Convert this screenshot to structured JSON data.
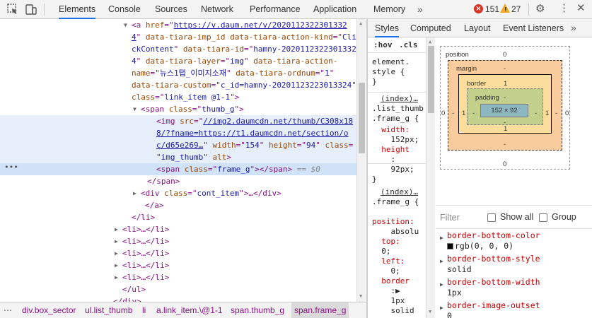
{
  "toolbar": {
    "tabs": [
      "Elements",
      "Console",
      "Sources",
      "Network",
      "Performance",
      "Application",
      "Memory"
    ],
    "more": "»",
    "errors": "151",
    "warnings": "27",
    "error_icon": "×",
    "warn_icon": "!"
  },
  "dom": {
    "rows": [
      [
        {
          "c": "tri",
          "t": "▼"
        },
        {
          "c": "tag",
          "t": "<a "
        },
        {
          "c": "attr",
          "t": "href"
        },
        {
          "c": "tag",
          "t": "=\""
        },
        {
          "c": "link",
          "t": "https://v.daum.net/v/2020112322301332"
        }
      ],
      [
        {
          "c": "link",
          "t": "4"
        },
        {
          "c": "tag",
          "t": "\" "
        },
        {
          "c": "attr",
          "t": "data-tiara-imp_id"
        },
        {
          "c": "tag",
          "t": " "
        },
        {
          "c": "attr",
          "t": "data-tiara-action-kind"
        },
        {
          "c": "tag",
          "t": "=\""
        },
        {
          "c": "val",
          "t": "Cli"
        }
      ],
      [
        {
          "c": "val",
          "t": "ckContent"
        },
        {
          "c": "tag",
          "t": "\" "
        },
        {
          "c": "attr",
          "t": "data-tiara-id"
        },
        {
          "c": "tag",
          "t": "=\""
        },
        {
          "c": "val",
          "t": "hamny-2020112322301332"
        }
      ],
      [
        {
          "c": "val",
          "t": "4"
        },
        {
          "c": "tag",
          "t": "\" "
        },
        {
          "c": "attr",
          "t": "data-tiara-layer"
        },
        {
          "c": "tag",
          "t": "=\""
        },
        {
          "c": "val",
          "t": "img"
        },
        {
          "c": "tag",
          "t": "\" "
        },
        {
          "c": "attr",
          "t": "data-tiara-action-"
        }
      ],
      [
        {
          "c": "attr",
          "t": "name"
        },
        {
          "c": "tag",
          "t": "=\""
        },
        {
          "c": "val",
          "t": "뉴스1탭_이미지소재"
        },
        {
          "c": "tag",
          "t": "\" "
        },
        {
          "c": "attr",
          "t": "data-tiara-ordnum"
        },
        {
          "c": "tag",
          "t": "=\""
        },
        {
          "c": "val",
          "t": "1"
        },
        {
          "c": "tag",
          "t": "\""
        }
      ],
      [
        {
          "c": "attr",
          "t": "data-tiara-custom"
        },
        {
          "c": "tag",
          "t": "=\""
        },
        {
          "c": "val",
          "t": "c_id=hamny-20201123223013324"
        },
        {
          "c": "tag",
          "t": "\""
        }
      ],
      [
        {
          "c": "attr",
          "t": "class"
        },
        {
          "c": "tag",
          "t": "=\""
        },
        {
          "c": "val",
          "t": "link_item @1-1"
        },
        {
          "c": "tag",
          "t": "\">"
        }
      ],
      [
        {
          "c": "tri",
          "t": "▼"
        },
        {
          "c": "tag",
          "t": "<span "
        },
        {
          "c": "attr",
          "t": "class"
        },
        {
          "c": "tag",
          "t": "=\""
        },
        {
          "c": "val",
          "t": "thumb_g"
        },
        {
          "c": "tag",
          "t": "\">"
        }
      ],
      [
        {
          "c": "tag",
          "t": "<img "
        },
        {
          "c": "attr",
          "t": "src"
        },
        {
          "c": "tag",
          "t": "=\""
        },
        {
          "c": "link",
          "t": "//img2.daumcdn.net/thumb/C308x18"
        }
      ],
      [
        {
          "c": "link",
          "t": "8/?fname=https://t1.daumcdn.net/section/o"
        }
      ],
      [
        {
          "c": "link",
          "t": "c/d65e269…"
        },
        {
          "c": "tag",
          "t": "\" "
        },
        {
          "c": "attr",
          "t": "width"
        },
        {
          "c": "tag",
          "t": "=\""
        },
        {
          "c": "val",
          "t": "154"
        },
        {
          "c": "tag",
          "t": "\" "
        },
        {
          "c": "attr",
          "t": "height"
        },
        {
          "c": "tag",
          "t": "=\""
        },
        {
          "c": "val",
          "t": "94"
        },
        {
          "c": "tag",
          "t": "\" "
        },
        {
          "c": "attr",
          "t": "class"
        },
        {
          "c": "tag",
          "t": "="
        }
      ],
      [
        {
          "c": "tag",
          "t": "\""
        },
        {
          "c": "val",
          "t": "img_thumb"
        },
        {
          "c": "tag",
          "t": "\" "
        },
        {
          "c": "attr",
          "t": "alt"
        },
        {
          "c": "tag",
          "t": ">"
        }
      ],
      [
        {
          "c": "tag",
          "t": "<span "
        },
        {
          "c": "attr",
          "t": "class"
        },
        {
          "c": "tag",
          "t": "=\""
        },
        {
          "c": "val",
          "t": "frame_g"
        },
        {
          "c": "tag",
          "t": "\"></span>"
        },
        {
          "c": "dim",
          "t": " == $0"
        }
      ],
      [
        {
          "c": "tag",
          "t": "</span>"
        }
      ],
      [
        {
          "c": "tri",
          "t": "▶"
        },
        {
          "c": "tag",
          "t": "<div "
        },
        {
          "c": "attr",
          "t": "class"
        },
        {
          "c": "tag",
          "t": "=\""
        },
        {
          "c": "val",
          "t": "cont_item"
        },
        {
          "c": "tag",
          "t": "\">…</div>"
        }
      ],
      [
        {
          "c": "tag",
          "t": "</a>"
        }
      ],
      [
        {
          "c": "tag",
          "t": "</li>"
        }
      ],
      [
        {
          "c": "tri",
          "t": "▶"
        },
        {
          "c": "tag",
          "t": "<li>…</li>"
        }
      ],
      [
        {
          "c": "tri",
          "t": "▶"
        },
        {
          "c": "tag",
          "t": "<li>…</li>"
        }
      ],
      [
        {
          "c": "tri",
          "t": "▶"
        },
        {
          "c": "tag",
          "t": "<li>…</li>"
        }
      ],
      [
        {
          "c": "tri",
          "t": "▶"
        },
        {
          "c": "tag",
          "t": "<li>…</li>"
        }
      ],
      [
        {
          "c": "tri",
          "t": "▶"
        },
        {
          "c": "tag",
          "t": "<li>…</li>"
        }
      ],
      [
        {
          "c": "tag",
          "t": "</ul>"
        }
      ],
      [
        {
          "c": "tag",
          "t": "</div>"
        }
      ]
    ],
    "selected_marker": "•••"
  },
  "breadcrumbs": [
    "div.box_sector",
    "ul.list_thumb",
    "li",
    "a.link_item.\\@1-1",
    "span.thumb_g",
    "span.frame_g"
  ],
  "sidebar": {
    "tabs": [
      "Styles",
      "Computed",
      "Layout",
      "Event Listeners"
    ],
    "more": "»"
  },
  "styles": {
    "hov": ":hov",
    "cls": ".cls",
    "lines": [
      {
        "c": "sel",
        "t": "element."
      },
      {
        "c": "sel",
        "t": "style {"
      },
      {
        "c": "sel",
        "t": "}"
      },
      {
        "c": "src",
        "t": "(index)…"
      },
      {
        "c": "sel",
        "t": ".list_thumb"
      },
      {
        "c": "sel",
        "t": ".frame_g {"
      },
      {
        "c": "prop",
        "t": "  width:"
      },
      {
        "c": "pval",
        "t": "    152px;"
      },
      {
        "c": "prop",
        "t": "  height"
      },
      {
        "c": "pval",
        "t": "    :"
      },
      {
        "c": "pval",
        "t": "    92px;"
      },
      {
        "c": "sel",
        "t": "}"
      },
      {
        "c": "src",
        "t": "(index)…"
      },
      {
        "c": "sel",
        "t": ".frame_g {"
      },
      {
        "c": "sel",
        "t": ""
      },
      {
        "c": "prop",
        "t": "position:"
      },
      {
        "c": "pval",
        "t": "    absolu"
      },
      {
        "c": "prop",
        "t": "  top:"
      },
      {
        "c": "pval",
        "t": "  0;"
      },
      {
        "c": "prop",
        "t": "  left:"
      },
      {
        "c": "pval",
        "t": "    0;"
      },
      {
        "c": "prop",
        "t": "  border"
      },
      {
        "c": "pval",
        "t": "    :▶"
      },
      {
        "c": "pval",
        "t": "    1px"
      },
      {
        "c": "pval",
        "t": "    solid"
      }
    ]
  },
  "boxmodel": {
    "position_label": "position",
    "position_top": "0",
    "position_left": "0",
    "position_right": "0",
    "position_bottom": "0",
    "margin_label": "margin",
    "margin_top": "-",
    "margin_left": "-",
    "margin_right": "-",
    "margin_bottom": "-",
    "border_label": "border",
    "border_top": "1",
    "border_left": "1",
    "border_right": "1",
    "border_bottom": "1",
    "padding_label": "padding",
    "padding_top": "-",
    "padding_left": "-",
    "padding_right": "-",
    "padding_bottom": "-",
    "content": "152 × 92"
  },
  "computed": {
    "filter_placeholder": "Filter",
    "show_all": "Show all",
    "group": "Group",
    "props": [
      {
        "name": "border-bottom-color",
        "value": "rgb(0, 0, 0)",
        "swatch": "#000000"
      },
      {
        "name": "border-bottom-style",
        "value": "solid"
      },
      {
        "name": "border-bottom-width",
        "value": "1px"
      },
      {
        "name": "border-image-outset",
        "value": "0"
      }
    ]
  }
}
